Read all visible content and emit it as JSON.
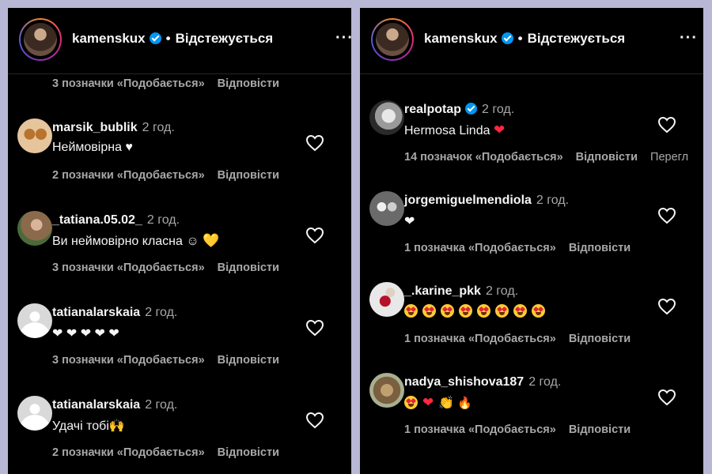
{
  "left": {
    "header": {
      "username": "kamenskux",
      "dot": "•",
      "follow_label": "Відстежується",
      "more_label": "···"
    },
    "top_meta": {
      "likes": "3 позначки «Подобається»",
      "reply": "Відповісти"
    },
    "comments": [
      {
        "username": "marsik_bublik",
        "time": "2 год.",
        "text": "Неймовірна ♥",
        "likes": "2 позначки «Подобається»",
        "reply": "Відповісти"
      },
      {
        "username": "_tatiana.05.02_",
        "time": "2 год.",
        "text": "Ви неймовірно класна ☺",
        "emoji": "💛",
        "likes": "3 позначки «Подобається»",
        "reply": "Відповісти"
      },
      {
        "username": "tatianalarskaia",
        "time": "2 год.",
        "text": "❤ ❤ ❤ ❤ ❤",
        "likes": "3 позначки «Подобається»",
        "reply": "Відповісти"
      },
      {
        "username": "tatianalarskaia",
        "time": "2 год.",
        "text": "Удачі тобі",
        "emoji": "🙌",
        "likes": "2 позначки «Подобається»",
        "reply": "Відповісти"
      }
    ]
  },
  "right": {
    "header": {
      "username": "kamenskux",
      "dot": "•",
      "follow_label": "Відстежується",
      "more_label": "···"
    },
    "comments": [
      {
        "username": "realpotap",
        "time": "2 год.",
        "text": "Hermosa Linda",
        "emoji": "❤",
        "likes": "14 позначок «Подобається»",
        "reply": "Відповісти",
        "extra": "Перегл"
      },
      {
        "username": "jorgemiguelmendiola",
        "time": "2 год.",
        "text": "❤",
        "likes": "1 позначка «Подобається»",
        "reply": "Відповісти"
      },
      {
        "username": "_.karine_pkk",
        "time": "2 год.",
        "text": "",
        "likes": "1 позначка «Подобається»",
        "reply": "Відповісти"
      },
      {
        "username": "nadya_shishova187",
        "time": "2 год.",
        "text": "",
        "emoji_heart": "❤",
        "emoji_hands": "👏",
        "emoji_fire": "🔥",
        "likes": "1 позначка «Подобається»",
        "reply": "Відповісти"
      }
    ]
  },
  "colors": {
    "background": "#000000",
    "text": "#f5f5f5",
    "muted": "#a8a8a8",
    "verified": "#0095f6",
    "heart": "#ff2740",
    "frame": "#b9b7d6"
  },
  "icons": {
    "heart_outline": "heart-outline-icon",
    "verified": "verified-badge-icon",
    "more": "more-dots-icon"
  }
}
